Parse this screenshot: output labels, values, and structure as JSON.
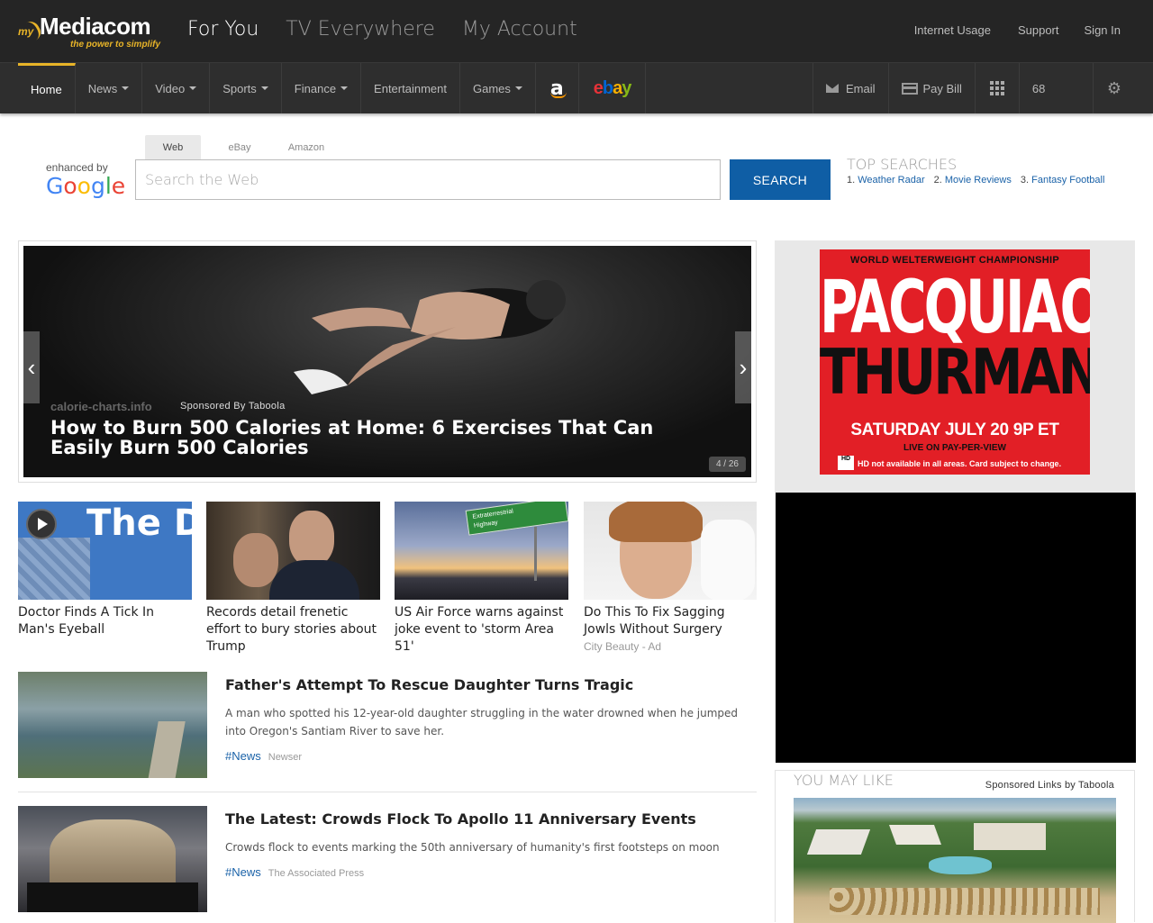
{
  "header": {
    "logo": {
      "prefix": "my",
      "name": "Mediacom",
      "tagline": "the power to simplify"
    },
    "main_nav": [
      "For You",
      "TV Everywhere",
      "My Account"
    ],
    "util_nav": {
      "internet_usage": "Internet Usage",
      "support": "Support",
      "sign_in": "Sign In"
    }
  },
  "subnav": {
    "items": [
      {
        "label": "Home",
        "dropdown": false
      },
      {
        "label": "News",
        "dropdown": true
      },
      {
        "label": "Video",
        "dropdown": true
      },
      {
        "label": "Sports",
        "dropdown": true
      },
      {
        "label": "Finance",
        "dropdown": true
      },
      {
        "label": "Entertainment",
        "dropdown": false
      },
      {
        "label": "Games",
        "dropdown": true
      }
    ],
    "amazon_glyph": "a",
    "ebay": {
      "e": "e",
      "b": "b",
      "a": "a",
      "y": "y"
    },
    "email": "Email",
    "pay_bill": "Pay Bill",
    "temperature": "68"
  },
  "search": {
    "enhanced_by": "enhanced by",
    "google": {
      "g1": "G",
      "o1": "o",
      "o2": "o",
      "g2": "g",
      "l": "l",
      "e": "e"
    },
    "tabs": [
      "Web",
      "eBay",
      "Amazon"
    ],
    "placeholder": "Search the Web",
    "button": "SEARCH",
    "top_searches_title": "TOP SEARCHES",
    "top_searches": [
      {
        "n": "1.",
        "label": "Weather Radar"
      },
      {
        "n": "2.",
        "label": "Movie Reviews"
      },
      {
        "n": "3.",
        "label": "Fantasy Football"
      }
    ]
  },
  "hero": {
    "source": "calorie-charts.info",
    "sponsored": "Sponsored By Taboola",
    "title": "How to Burn 500 Calories at Home: 6 Exercises That Can Easily Burn 500 Calories",
    "counter": "4 / 26"
  },
  "tiles": [
    {
      "caption": "Doctor Finds A Tick In Man's Eyeball",
      "ad": ""
    },
    {
      "caption": "Records detail frenetic effort to bury stories about Trump",
      "ad": ""
    },
    {
      "caption": "US Air Force warns against joke event to 'storm Area 51'",
      "ad": ""
    },
    {
      "caption": "Do This To Fix Sagging Jowls Without Surgery",
      "ad": "City Beauty - Ad"
    }
  ],
  "tile_overlays": {
    "doctor_text": "The Docto",
    "sign_top": "Extraterrestrial",
    "sign_bottom": "Highway"
  },
  "articles": [
    {
      "title": "Father's Attempt To Rescue Daughter Turns Tragic",
      "desc": "A man who spotted his 12-year-old daughter struggling in the water drowned when he jumped into Oregon's Santiam River to save her.",
      "tag": "#News",
      "source": "Newser"
    },
    {
      "title": "The Latest: Crowds Flock To Apollo 11 Anniversary Events",
      "desc": "Crowds flock to events marking the 50th anniversary of humanity's first footsteps on moon",
      "tag": "#News",
      "source": "The Associated Press"
    }
  ],
  "ad": {
    "line1": "WORLD WELTERWEIGHT CHAMPIONSHIP",
    "line2": "PACQUIAO",
    "line3": "THURMAN",
    "line4": "SATURDAY JULY 20 9P ET",
    "line5": "LIVE ON PAY-PER-VIEW",
    "hd_badge": "HD",
    "line6": "HD not available in all areas. Card subject to change."
  },
  "you_may_like": {
    "title": "YOU MAY LIKE",
    "sponsored": "Sponsored Links by Taboola"
  },
  "colors": {
    "accent": "#e8b428",
    "search_button": "#0f5ea5",
    "link": "#1a62a8",
    "ad_red": "#e21f26"
  }
}
